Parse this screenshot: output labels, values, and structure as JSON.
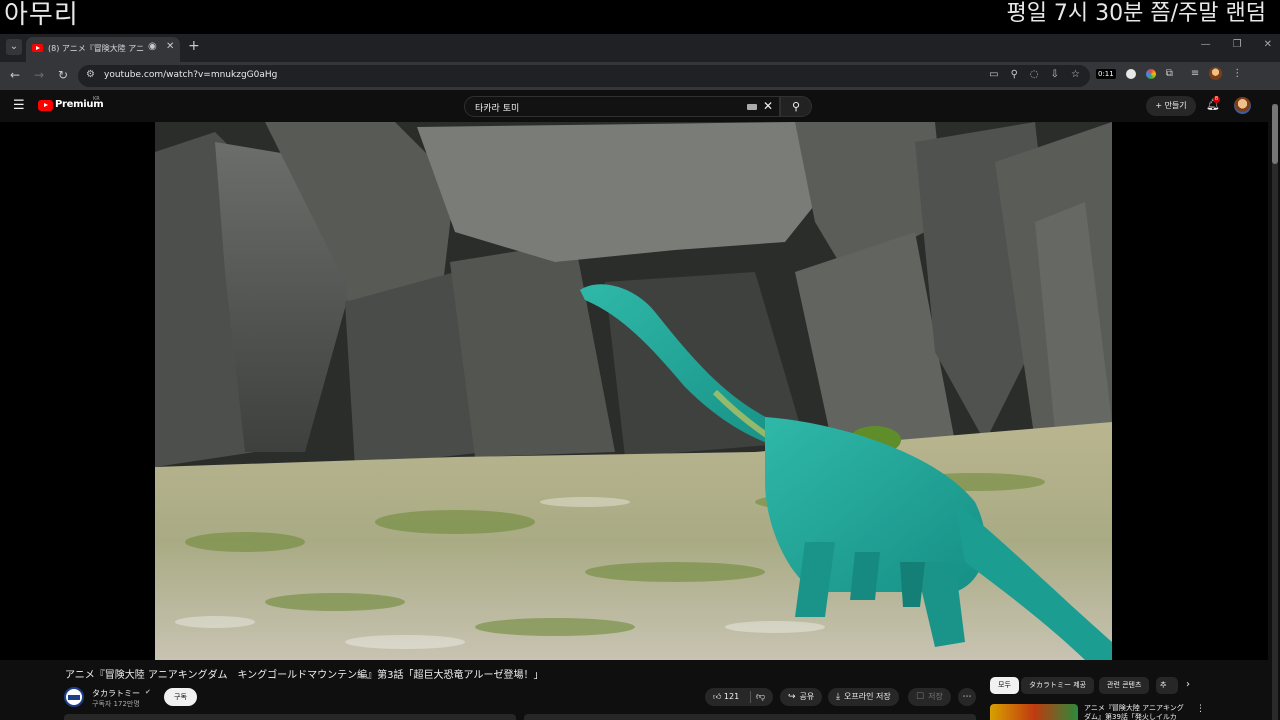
{
  "overlay": {
    "left_text": "아무리",
    "right_text": "평일 7시 30분 쯤/주말 랜덤"
  },
  "browser": {
    "tab_title": "(8) アニメ『冒険大陸 アニア",
    "url": "youtube.com/watch?v=mnukzgG0aHg",
    "extension_badge": "0:11"
  },
  "youtube": {
    "brand": "Premium",
    "region": "KR",
    "search_query": "타카라 토미",
    "create_label": "만들기",
    "notification_count": "8"
  },
  "video": {
    "title": "アニメ『冒険大陸 アニアキングダム　キングゴールドマウンテン編』第3話「超巨大恐竜アルーゼ登場！」",
    "channel_name": "タカラトミー",
    "subscribers": "구독자 172만명",
    "subscribe_label": "구독",
    "likes": "121",
    "share_label": "공유",
    "offline_label": "오프라인 저장",
    "save_label": "저장"
  },
  "chips": [
    "모두",
    "タカラトミー 제공",
    "관련 콘텐츠",
    "추"
  ],
  "recommendation": {
    "title": "アニメ『冒険大陸 アニアキングダム』第39話「発火しイルカ"
  },
  "colors": {
    "background": "#0f0f0f",
    "youtube_red": "#ff0000",
    "dinosaur": "#1fa69a"
  }
}
